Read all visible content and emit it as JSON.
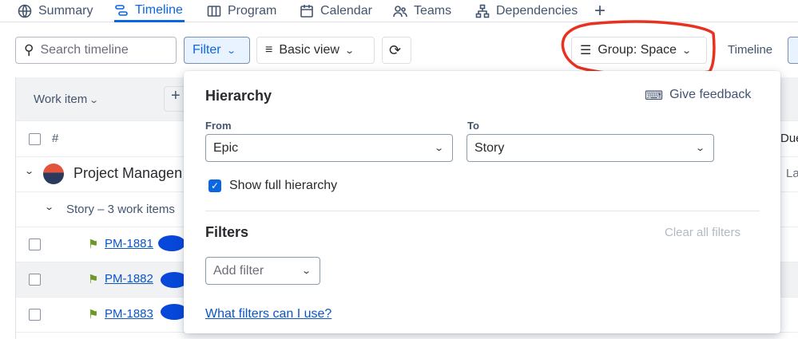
{
  "tabs": [
    {
      "label": "Summary",
      "icon": "globe-icon"
    },
    {
      "label": "Timeline",
      "icon": "timeline-icon",
      "active": true
    },
    {
      "label": "Program",
      "icon": "columns-icon"
    },
    {
      "label": "Calendar",
      "icon": "calendar-icon"
    },
    {
      "label": "Teams",
      "icon": "teams-icon"
    },
    {
      "label": "Dependencies",
      "icon": "hierarchy-icon"
    }
  ],
  "add_tab": "+",
  "toolbar": {
    "search_placeholder": "Search timeline",
    "filter": "Filter",
    "basic_view": "Basic view",
    "group": "Group: Space",
    "timeline": "Timeline"
  },
  "table": {
    "work_item": "Work item",
    "add": "+",
    "hash": "#",
    "due": "Due",
    "project": "Project Managen",
    "project_due": "La",
    "group_label": "Story – 3 work items",
    "rows": [
      "PM-1881",
      "PM-1882",
      "PM-1883"
    ]
  },
  "popup": {
    "hierarchy": "Hierarchy",
    "feedback": "Give feedback",
    "from_label": "From",
    "from_value": "Epic",
    "to_label": "To",
    "to_value": "Story",
    "show_full": "Show full hierarchy",
    "filters": "Filters",
    "clear": "Clear all filters",
    "add_filter": "Add filter",
    "help": "What filters can I use?"
  },
  "colors": {
    "accent": "#0c66e4",
    "annotation": "#e8321f"
  }
}
